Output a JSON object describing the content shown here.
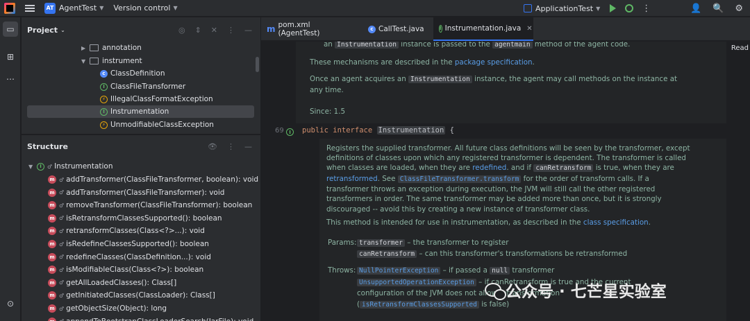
{
  "titlebar": {
    "project_badge": "AT",
    "project_name": "AgentTest",
    "vcs": "Version control",
    "run_config": "ApplicationTest"
  },
  "project_panel": {
    "title": "Project",
    "items": [
      {
        "label": "annotation",
        "type": "folder",
        "expanded": false
      },
      {
        "label": "instrument",
        "type": "folder",
        "expanded": true
      },
      {
        "label": "ClassDefinition",
        "type": "class"
      },
      {
        "label": "ClassFileTransformer",
        "type": "interface"
      },
      {
        "label": "IllegalClassFormatException",
        "type": "exception"
      },
      {
        "label": "Instrumentation",
        "type": "interface",
        "selected": true
      },
      {
        "label": "UnmodifiableClassException",
        "type": "exception"
      }
    ]
  },
  "structure_panel": {
    "title": "Structure",
    "root": "Instrumentation",
    "methods": [
      "addTransformer(ClassFileTransformer, boolean): void",
      "addTransformer(ClassFileTransformer): void",
      "removeTransformer(ClassFileTransformer): boolean",
      "isRetransformClassesSupported(): boolean",
      "retransformClasses(Class<?>...): void",
      "isRedefineClassesSupported(): boolean",
      "redefineClasses(ClassDefinition...): void",
      "isModifiableClass(Class<?>): boolean",
      "getAllLoadedClasses(): Class[]",
      "getInitiatedClasses(ClassLoader): Class[]",
      "getObjectSize(Object): long",
      "appendToBootstrapClassLoaderSearch(JarFile): void"
    ]
  },
  "tabs": [
    {
      "label": "pom.xml (AgentTest)",
      "icon": "maven-icon"
    },
    {
      "label": "CallTest.java",
      "icon": "class-icon"
    },
    {
      "label": "Instrumentation.java",
      "icon": "interface-icon",
      "active": true
    }
  ],
  "editor": {
    "reader_mode": "Read",
    "doc_top": {
      "l1_pre": "an",
      "l1_chip1": "Instrumentation",
      "l1_mid": "instance is passed to the",
      "l1_chip2": "agentmain",
      "l1_post": "method of the agent code.",
      "l2_pre": "These mechanisms are described in the",
      "l2_link": "package specification",
      "l2_post": ".",
      "l3_pre": "Once an agent acquires an",
      "l3_chip": "Instrumentation",
      "l3_post": "instance, the agent may call methods on the instance at",
      "l4": "any time.",
      "since": "Since: 1.5"
    },
    "line_number": "69",
    "code": {
      "kw1": "public",
      "kw2": "interface",
      "name": "Instrumentation",
      "brace": "{"
    },
    "doc_main": {
      "p1": "Registers the supplied transformer. All future class definitions will be seen by the transformer, except",
      "p2": "definitions of classes upon which any registered transformer is dependent. The transformer is called",
      "p3_pre": "when classes are loaded, when they are",
      "p3_link": "redefined",
      "p3_mid": ". and if",
      "p3_chip": "canRetransform",
      "p3_post": "is true, when they are",
      "p4_link": "retransformed",
      "p4_mid": ". See",
      "p4_chip": "ClassFileTransformer.transform",
      "p4_post": "for the order of transform calls. If a",
      "p5": "transformer throws an exception during execution, the JVM will still call the other registered",
      "p6": "transformers in order. The same transformer may be added more than once, but it is strongly",
      "p7": "discouraged -- avoid this by creating a new instance of transformer class.",
      "p8_pre": "This method is intended for use in instrumentation, as described in the",
      "p8_link": "class specification",
      "p8_post": ".",
      "params_label": "Params:",
      "param1_chip": "transformer",
      "param1_text": "– the transformer to register",
      "param2_chip": "canRetransform",
      "param2_text": "– can this transformer's transformations be retransformed",
      "throws_label": "Throws:",
      "t1_chip": "NullPointerException",
      "t1_mid": "– if passed a",
      "t1_chip2": "null",
      "t1_post": "transformer",
      "t2_chip": "UnsupportedOperationException",
      "t2_post": "– if canRetransform is true and the current",
      "t3": "configuration of the JVM does not allow retransformation",
      "t4_chip": "isRetransformClassesSupported",
      "t4_post": "is false)",
      "t4_pre": "("
    }
  },
  "watermark": "公众号 · 七芒星实验室"
}
